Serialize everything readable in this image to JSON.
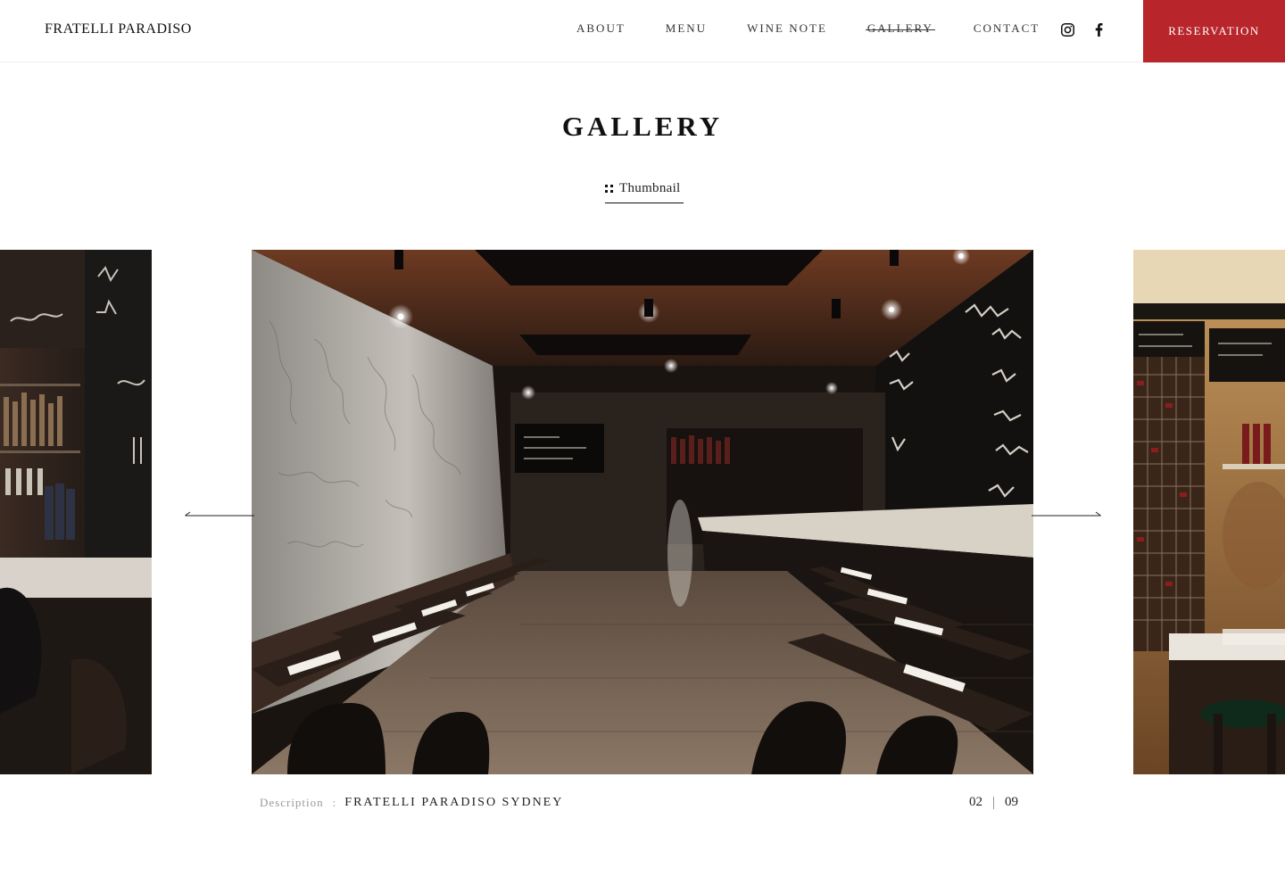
{
  "header": {
    "logo": "FRATELLI  PARADISO",
    "nav": [
      {
        "label": "ABOUT"
      },
      {
        "label": "MENU"
      },
      {
        "label": "WINE NOTE"
      },
      {
        "label": "GALLERY"
      },
      {
        "label": "CONTACT"
      }
    ],
    "active_nav": "GALLERY",
    "social": {
      "instagram_icon": "instagram-icon",
      "facebook_icon": "facebook-icon"
    },
    "reservation_label": "RESERVATION"
  },
  "page": {
    "title": "GALLERY",
    "thumbnail_toggle": "Thumbnail"
  },
  "gallery": {
    "description_label": "Description",
    "description_separator": ":",
    "description_text": "FRATELLI PARADISO SYDNEY",
    "current": "02",
    "total": "09"
  },
  "colors": {
    "accent": "#b8252a",
    "text": "#1a1a1a",
    "muted": "#999999"
  }
}
